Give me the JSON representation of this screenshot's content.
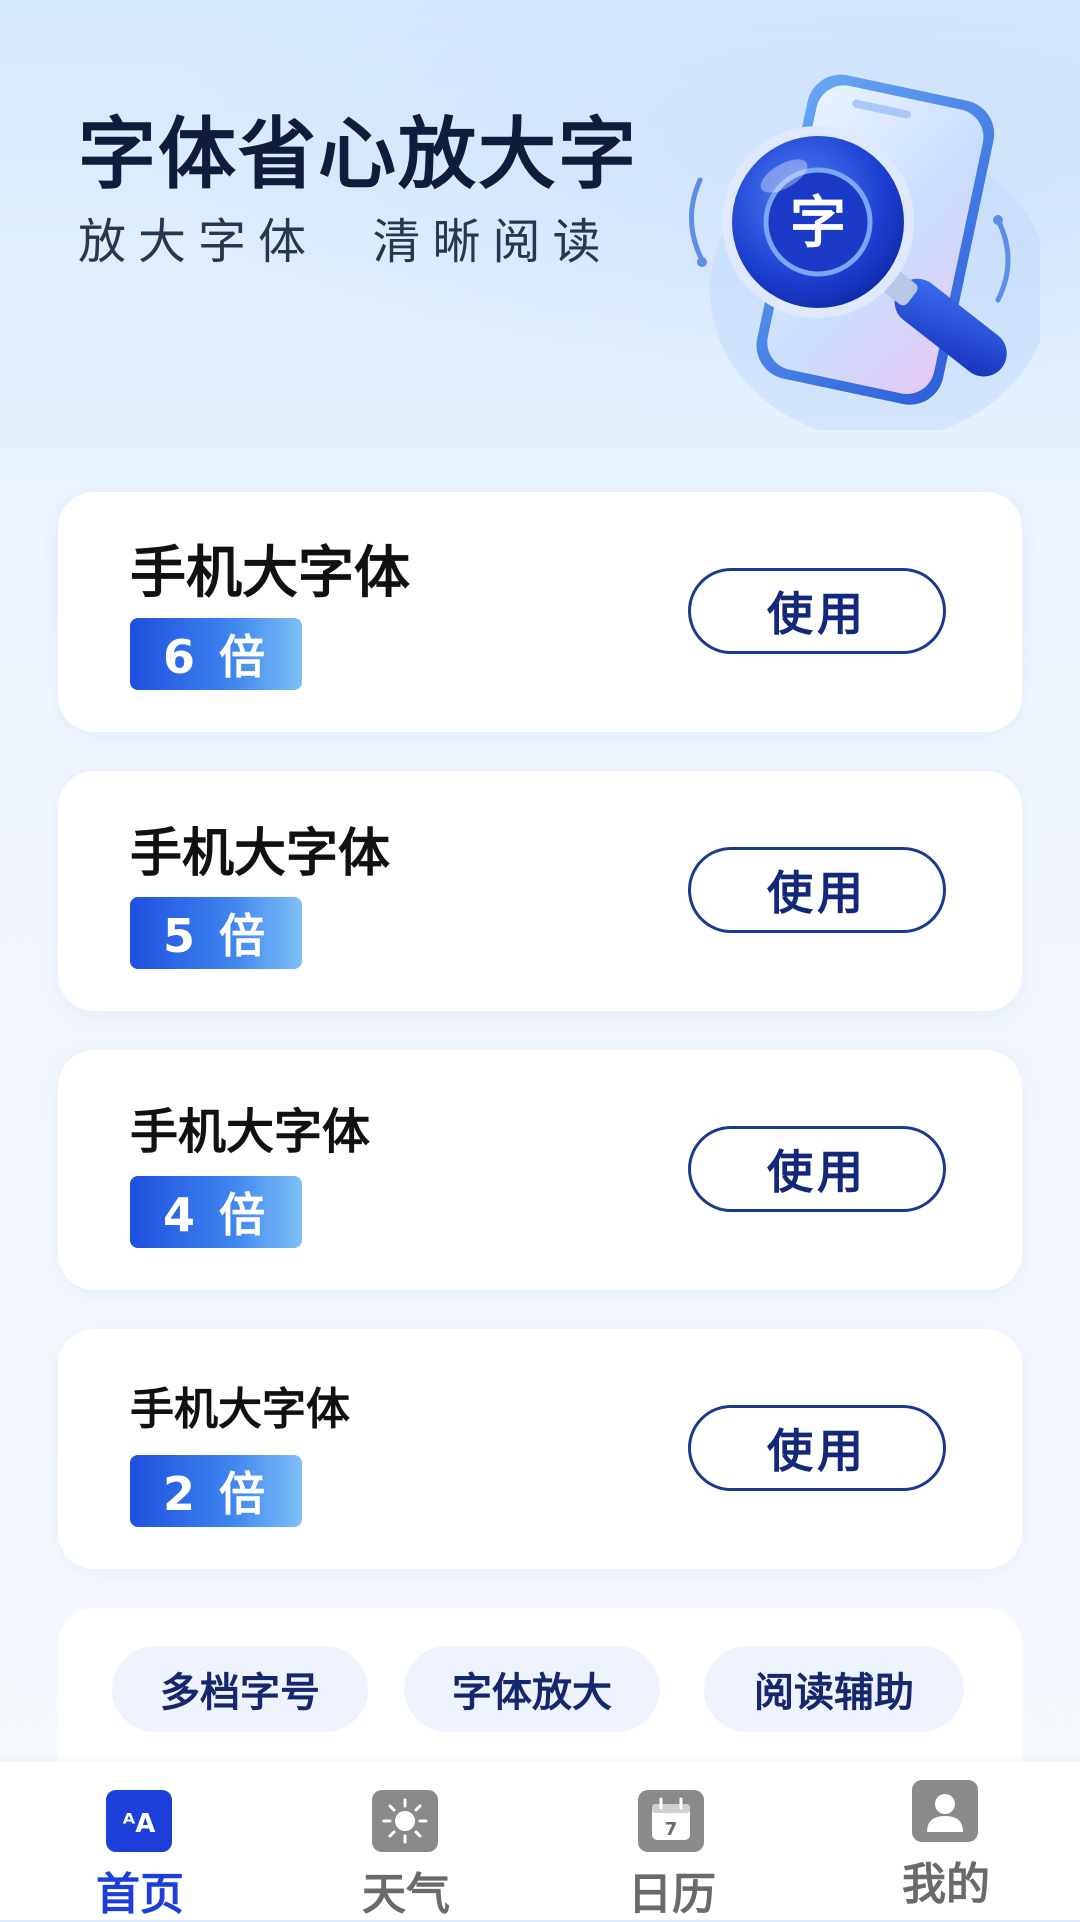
{
  "header": {
    "title": "字体省心放大字",
    "subtitle": "放大字体  清晰阅读",
    "hero_glyph": "字"
  },
  "cards": [
    {
      "title": "手机大字体",
      "badge": "6 倍",
      "button": "使用"
    },
    {
      "title": "手机大字体",
      "badge": "5 倍",
      "button": "使用"
    },
    {
      "title": "手机大字体",
      "badge": "4 倍",
      "button": "使用"
    },
    {
      "title": "手机大字体",
      "badge": "2 倍",
      "button": "使用"
    }
  ],
  "tags": [
    "多档字号",
    "字体放大",
    "阅读辅助"
  ],
  "nav": {
    "items": [
      {
        "label": "首页",
        "icon": "font-size-icon",
        "active": true
      },
      {
        "label": "天气",
        "icon": "sun-icon",
        "active": false
      },
      {
        "label": "日历",
        "icon": "calendar-icon",
        "active": false,
        "icon_text": "7"
      },
      {
        "label": "我的",
        "icon": "user-icon",
        "active": false
      }
    ]
  },
  "colors": {
    "accent": "#1b3fd8",
    "button_border": "#1a3a8e",
    "title_text": "#111c3c"
  }
}
